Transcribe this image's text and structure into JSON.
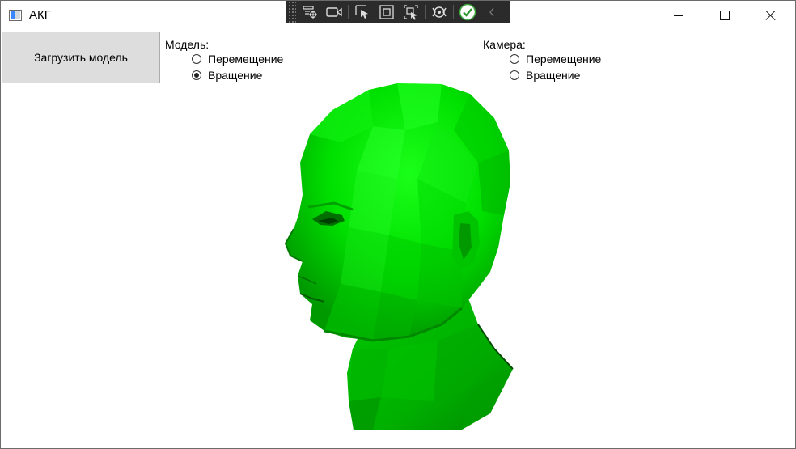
{
  "window": {
    "title": "АКГ"
  },
  "debug_toolbar": {
    "tools": [
      "live-visual-tree-icon",
      "record-icon",
      "select-element-icon",
      "display-layout-adorners-icon",
      "track-focus-icon",
      "hot-reload-icon",
      "checkmark-icon",
      "collapse-chevron-icon"
    ]
  },
  "load_button": {
    "label": "Загрузить модель"
  },
  "model_group": {
    "label": "Модель:",
    "options": [
      {
        "label": "Перемещение",
        "checked": false
      },
      {
        "label": "Вращение",
        "checked": true
      }
    ]
  },
  "camera_group": {
    "label": "Камера:",
    "options": [
      {
        "label": "Перемещение",
        "checked": false
      },
      {
        "label": "Вращение",
        "checked": false
      }
    ]
  },
  "colors": {
    "model_fill": "#00e600",
    "toolbar_bg": "#2b2b2b",
    "button_bg": "#dddddd"
  },
  "render": {
    "model": "3d-head-mesh"
  }
}
